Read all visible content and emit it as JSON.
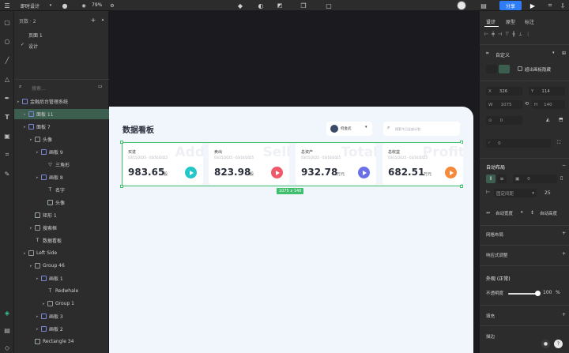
{
  "topbar": {
    "menu_label": "即时设计",
    "zoom": "79%",
    "share_label": "分享"
  },
  "layers": {
    "pages_label": "页数 · 2",
    "pages": [
      "页面 1",
      "设计"
    ],
    "search_placeholder": "搜索...",
    "tree": [
      {
        "label": "金融后台管理系统",
        "depth": 0,
        "type": "frame",
        "selected": false
      },
      {
        "label": "面板 11",
        "depth": 1,
        "type": "frame",
        "selected": true
      },
      {
        "label": "面板 7",
        "depth": 1,
        "type": "frame",
        "selected": false
      },
      {
        "label": "头像",
        "depth": 2,
        "type": "folder",
        "selected": false
      },
      {
        "label": "画板 9",
        "depth": 3,
        "type": "frame",
        "selected": false
      },
      {
        "label": "三角形",
        "depth": 4,
        "type": "shape",
        "selected": false
      },
      {
        "label": "画板 8",
        "depth": 3,
        "type": "frame",
        "selected": false
      },
      {
        "label": "名字",
        "depth": 4,
        "type": "text",
        "selected": false
      },
      {
        "label": "头像",
        "depth": 4,
        "type": "image",
        "selected": false
      },
      {
        "label": "矩形 1",
        "depth": 2,
        "type": "rect",
        "selected": false
      },
      {
        "label": "搜索框",
        "depth": 2,
        "type": "folder",
        "selected": false
      },
      {
        "label": "数据看板",
        "depth": 2,
        "type": "text",
        "selected": false
      },
      {
        "label": "Left Side",
        "depth": 1,
        "type": "folder",
        "selected": false
      },
      {
        "label": "Group 46",
        "depth": 2,
        "type": "folder",
        "selected": false
      },
      {
        "label": "画板 1",
        "depth": 3,
        "type": "frame",
        "selected": false
      },
      {
        "label": "Redwhale",
        "depth": 4,
        "type": "text",
        "selected": false
      },
      {
        "label": "Group 1",
        "depth": 4,
        "type": "folder",
        "selected": false
      },
      {
        "label": "画板 3",
        "depth": 3,
        "type": "frame",
        "selected": false
      },
      {
        "label": "画板 2",
        "depth": 3,
        "type": "frame",
        "selected": false
      },
      {
        "label": "Rectangle 34",
        "depth": 2,
        "type": "rect",
        "selected": false
      }
    ]
  },
  "board": {
    "title": "数据看板",
    "user": "何金武",
    "search_placeholder": "搜索今日全部计划",
    "selection_size": "1075 x 140",
    "cards": [
      {
        "label": "买进",
        "date": "03/15/2025 - 03/16/2025",
        "value": "983.65",
        "unit": "股",
        "ghost": "Add",
        "color": "#22c8c9"
      },
      {
        "label": "卖出",
        "date": "03/15/2025 - 03/16/2025",
        "value": "823.98",
        "unit": "股",
        "ghost": "Sell",
        "color": "#f0586a"
      },
      {
        "label": "总资产",
        "date": "03/15/2025 - 03/16/2025",
        "value": "932.78",
        "unit": "万元",
        "ghost": "Total",
        "color": "#6a70e8"
      },
      {
        "label": "总收益",
        "date": "03/15/2025 - 03/16/2025",
        "value": "682.51",
        "unit": "万元",
        "ghost": "Profit",
        "color": "#f58a3c"
      }
    ]
  },
  "right_panel": {
    "tabs": [
      "设计",
      "原型",
      "标注"
    ],
    "frame_type": "自定义",
    "clip_label": "超出画板隐藏",
    "x": "326",
    "y": "114",
    "w": "1075",
    "h": "140",
    "rotation": "0",
    "radius": "0",
    "auto_layout_label": "自动布局",
    "gap": "0",
    "spacing_mode": "固定间距",
    "spacing_value": "25",
    "auto_width": "自动宽度",
    "auto_height": "自动高度",
    "grid_label": "网格布局",
    "constraint_label": "响应式调整",
    "appearance_label": "外观 (正常)",
    "opacity_label": "不透明度",
    "opacity_value": "100",
    "opacity_unit": "%",
    "fill_label": "填充",
    "stroke_label": "描边"
  }
}
